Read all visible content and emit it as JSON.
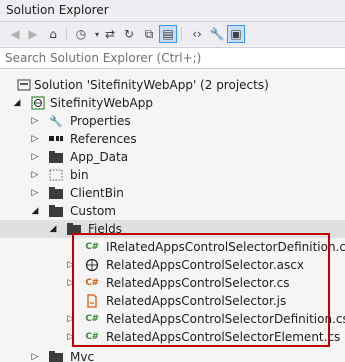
{
  "window": {
    "title": "Solution Explorer"
  },
  "search": {
    "placeholder": "Search Solution Explorer (Ctrl+;)"
  },
  "tree": {
    "solution": "Solution 'SitefinityWebApp' (2 projects)",
    "project": "SitefinityWebApp",
    "nodes": {
      "properties": "Properties",
      "references": "References",
      "app_data": "App_Data",
      "bin": "bin",
      "clientbin": "ClientBin",
      "custom": "Custom",
      "fields": "Fields",
      "mvc": "Mvc"
    },
    "files": [
      {
        "name": "IRelatedAppsControlSelectorDefinition.cs",
        "type": "cs"
      },
      {
        "name": "RelatedAppsControlSelector.ascx",
        "type": "ascx"
      },
      {
        "name": "RelatedAppsControlSelector.cs",
        "type": "cs"
      },
      {
        "name": "RelatedAppsControlSelector.js",
        "type": "js"
      },
      {
        "name": "RelatedAppsControlSelectorDefinition.cs",
        "type": "cs"
      },
      {
        "name": "RelatedAppsControlSelectorElement.cs",
        "type": "cs"
      }
    ]
  }
}
